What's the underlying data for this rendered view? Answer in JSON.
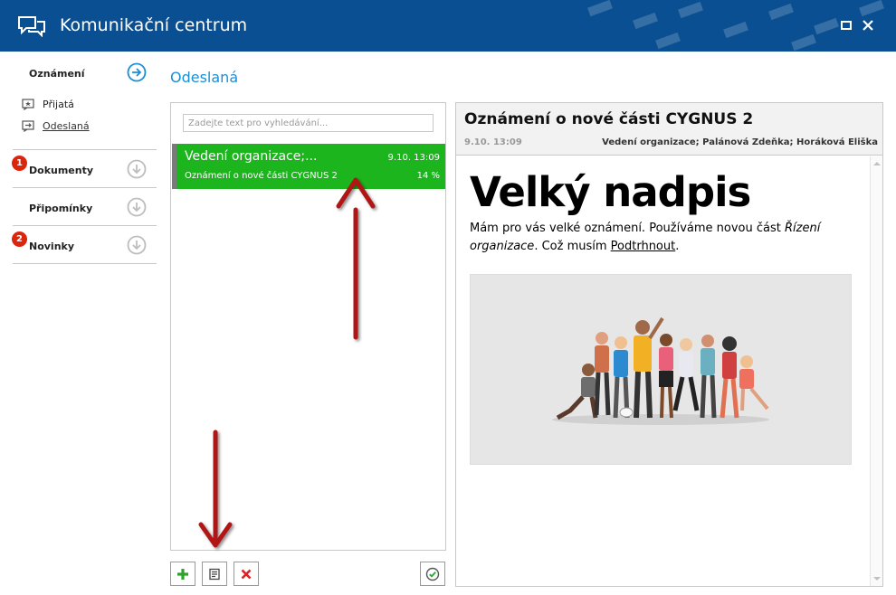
{
  "window": {
    "title": "Komunikační centrum"
  },
  "nav": {
    "sections": [
      {
        "label": "Oznámení",
        "expanded": true
      },
      {
        "label": "Dokumenty",
        "badge": "1"
      },
      {
        "label": "Připomínky"
      },
      {
        "label": "Novinky",
        "badge": "2"
      }
    ],
    "sub_items": [
      {
        "label": "Přijatá"
      },
      {
        "label": "Odeslaná",
        "active": true
      }
    ]
  },
  "section_title": "Odeslaná",
  "search": {
    "placeholder": "Zadejte text pro vyhledávání..."
  },
  "messages": [
    {
      "sender": "Vedení organizace;...",
      "date": "9.10.  13:09",
      "subject": "Oznámení o nové části CYGNUS 2",
      "percent": "14 %"
    }
  ],
  "detail": {
    "title": "Oznámení o nové části CYGNUS 2",
    "date": "9.10. 13:09",
    "recipients": "Vedení organizace; Palánová Zdeňka; Horáková Eliška",
    "heading": "Velký nadpis",
    "text_part1": "Mám pro vás velké oznámení. Používáme novou část ",
    "text_italic": "Řízení organizace",
    "text_part2": ". Což musím ",
    "text_underline": "Podtrhnout",
    "text_part3": "."
  },
  "colors": {
    "titlebar": "#0a4f91",
    "accent": "#1b8fd6",
    "selected_item": "#1db51d",
    "badge": "#d9260d",
    "arrow": "#b01515"
  },
  "icons": {
    "app": "chat-bubbles-icon",
    "maximize": "maximize-icon",
    "close": "close-icon",
    "add": "plus-icon",
    "edit": "document-icon",
    "delete": "delete-x-icon",
    "confirm": "check-circle-icon"
  }
}
